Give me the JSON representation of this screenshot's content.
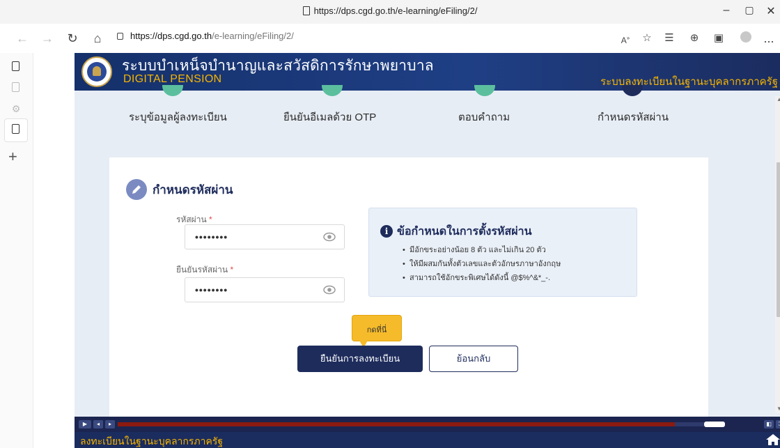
{
  "browser": {
    "window_title": "https://dps.cgd.go.th/e-learning/eFiling/2/",
    "url_host": "https://dps.cgd.go.th",
    "url_path": "/e-learning/eFiling/2/",
    "more_label": "..."
  },
  "app": {
    "title_th": "ระบบบำเหน็จบำนาญและสวัสดิการรักษาพยาบาล",
    "title_en": "DIGITAL PENSION",
    "subtitle_right": "ระบบลงทะเบียนในฐานะบุคลากรภาครัฐ"
  },
  "steps": [
    {
      "label": "ระบุข้อมูลผู้ลงทะเบียน",
      "state": "done"
    },
    {
      "label": "ยืนยันอีเมลด้วย OTP",
      "state": "done"
    },
    {
      "label": "ตอบคำถาม",
      "state": "done"
    },
    {
      "label": "กำหนดรหัสผ่าน",
      "state": "active"
    }
  ],
  "form": {
    "section_title": "กำหนดรหัสผ่าน",
    "password_label": "รหัสผ่าน",
    "password_value": "••••••••",
    "confirm_label": "ยืนยันรหัสผ่าน",
    "confirm_value": "••••••••",
    "required_mark": "*"
  },
  "rules": {
    "info_glyph": "i",
    "title": "ข้อกำหนดในการตั้งรหัสผ่าน",
    "items": [
      "มีอักขระอย่างน้อย 8 ตัว และไม่เกิน 20 ตัว",
      "ให้มีผสมกันทั้งตัวเลขและตัวอักษรภาษาอังกฤษ",
      "สามารถใช้อักขระพิเศษได้ดังนี้ @$%^&*_-."
    ]
  },
  "tooltip": {
    "text": "กดที่นี่"
  },
  "buttons": {
    "confirm": "ยืนยันการลงทะเบียน",
    "back": "ย้อนกลับ"
  },
  "footer": {
    "text": "ลงทะเบียนในฐานะบุคลากรภาครัฐ"
  },
  "player": {
    "progress": 0.95
  },
  "colors": {
    "navy": "#1e2c5c",
    "accent_gold": "#f5b400",
    "step_done": "#5bbf9e",
    "tooltip": "#f6bb2a",
    "progress": "#8b1a10"
  }
}
